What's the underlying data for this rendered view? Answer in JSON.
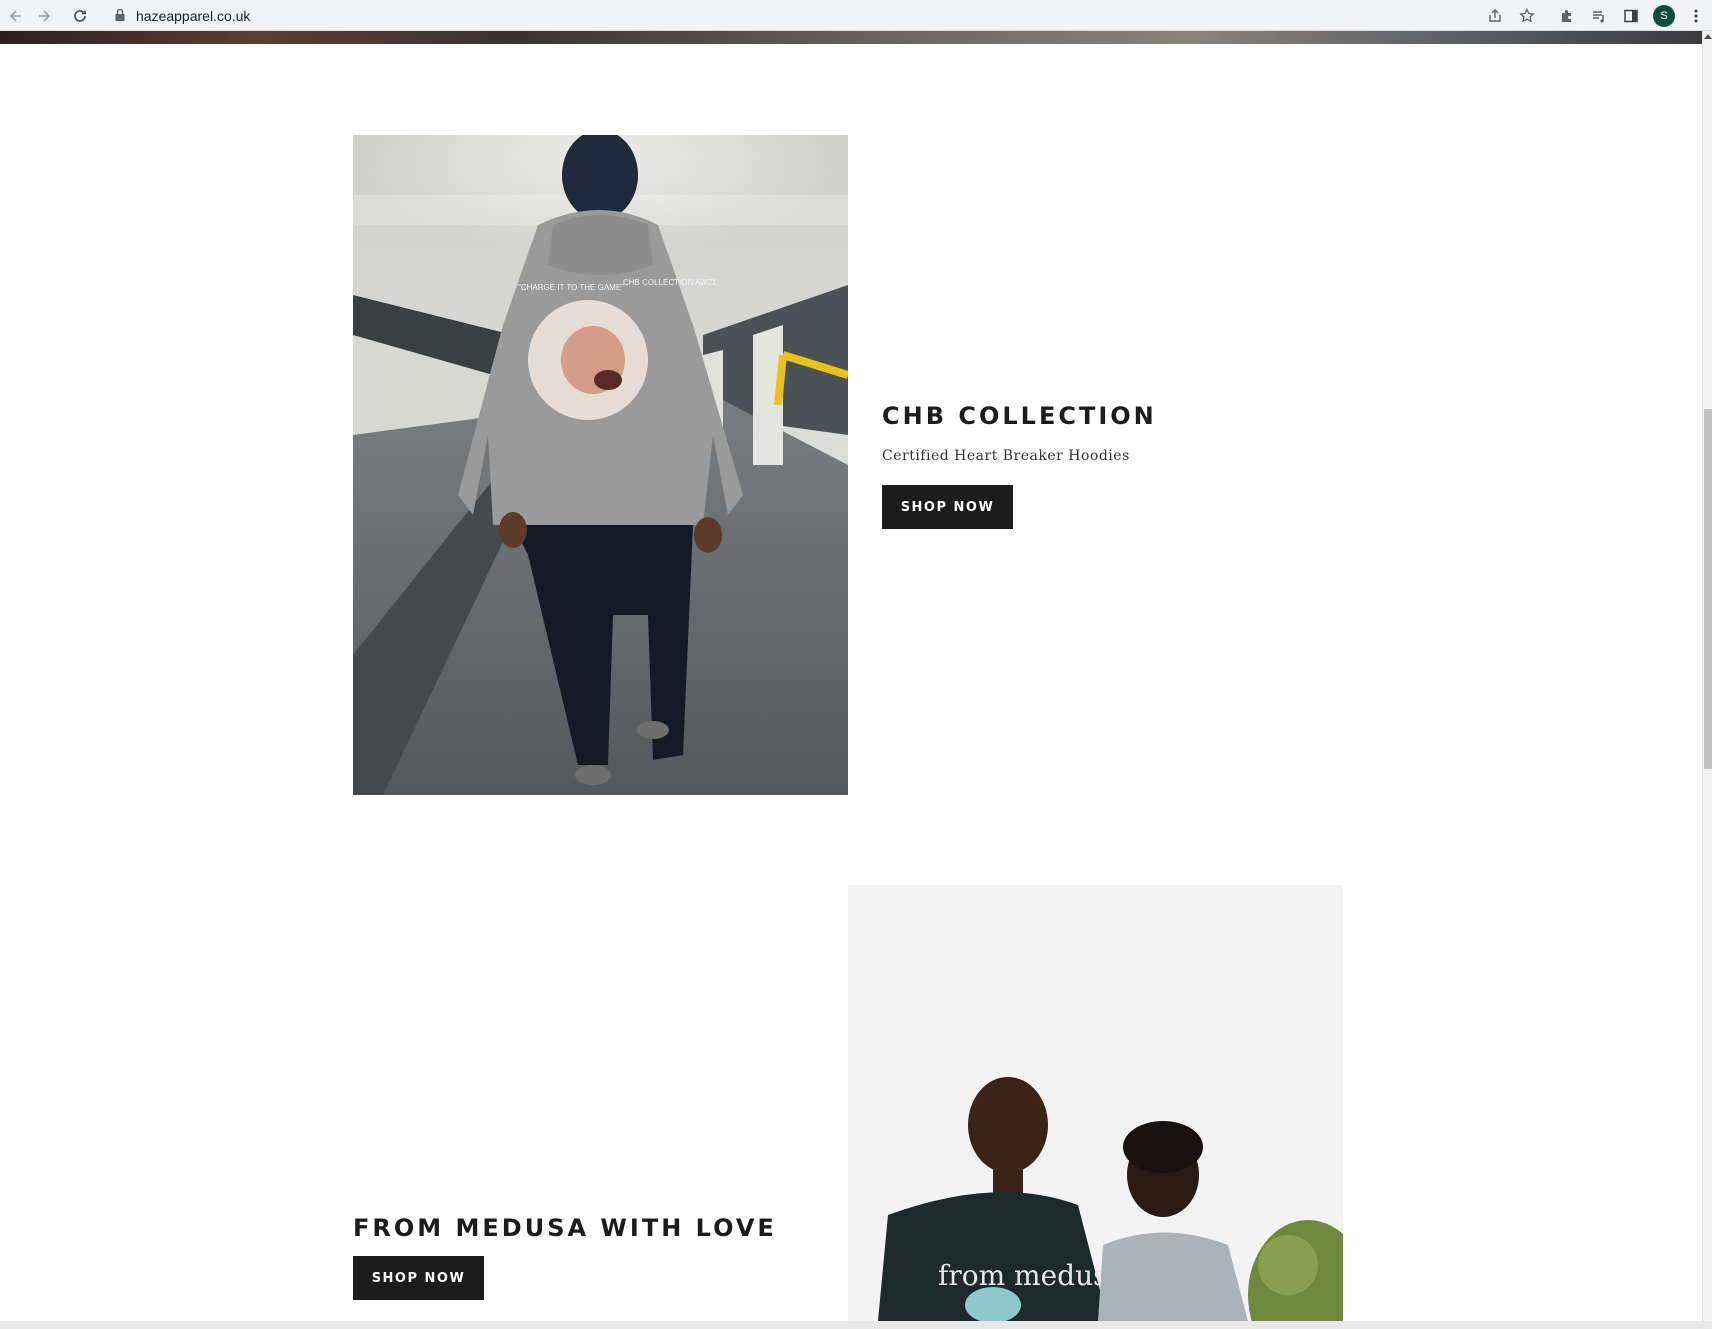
{
  "browser": {
    "url": "hazeapparel.co.uk",
    "profile_initial": "S"
  },
  "sections": [
    {
      "title": "CHB COLLECTION",
      "subtitle": "Certified Heart Breaker Hoodies",
      "button_label": "SHOP NOW",
      "image_alt": "hoodie-back-print-photo",
      "hoodie_print_left": "\"CHARGE IT TO THE GAME\"",
      "hoodie_print_right": "CHB COLLECTION AW21"
    },
    {
      "title": "FROM MEDUSA WITH LOVE",
      "button_label": "SHOP NOW",
      "image_alt": "medusa-tshirts-photo",
      "shirt_print": "from medusa"
    }
  ],
  "colors": {
    "button_bg": "#1c1c1c",
    "button_text": "#ffffff",
    "heading": "#1c1c1c"
  }
}
